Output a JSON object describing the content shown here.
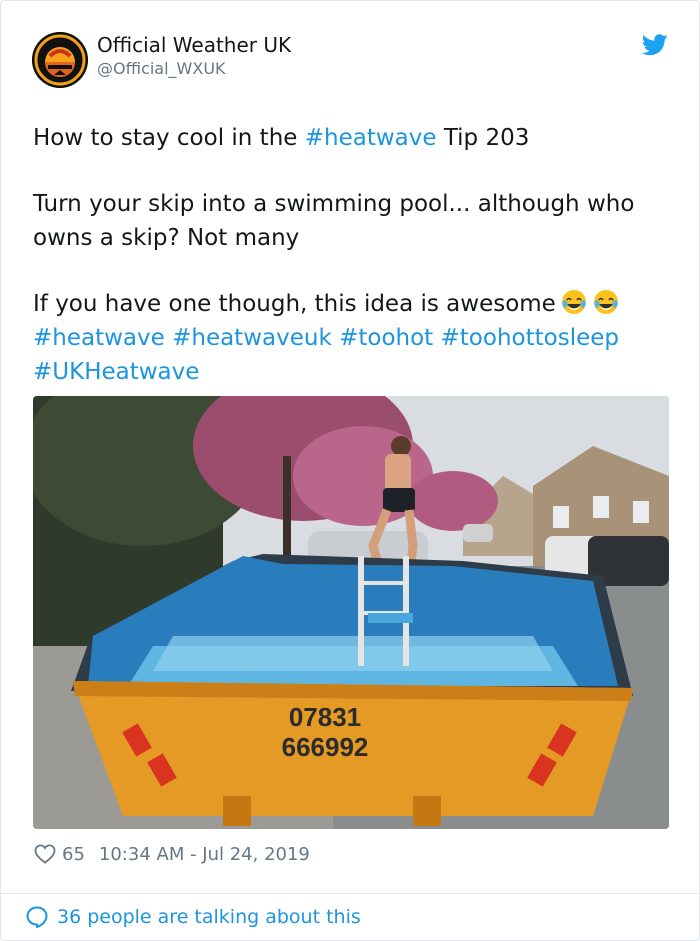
{
  "tweet": {
    "author": {
      "name": "Official Weather UK",
      "handle": "@Official_WXUK",
      "avatar_icon": "weather-logo-icon"
    },
    "brand_icon": "twitter-bird-icon",
    "lines": {
      "line1_pre": "How to stay cool in the ",
      "line1_tag": "#heatwave",
      "line1_post": " Tip 203",
      "para2": "Turn your skip into a swimming pool... although who owns a skip? Not many",
      "para3": "If you have one though, this idea is awesome",
      "emoji": "face-with-tears-of-joy",
      "tags": [
        "#heatwave",
        "#heatwaveuk",
        "#toohot",
        "#toohottosleep",
        "#UKHeatwave"
      ]
    },
    "image": {
      "skip_text_line1": "07831",
      "skip_text_line2": "666992"
    },
    "likes": "65",
    "timestamp": "10:34 AM - Jul 24, 2019",
    "footer": "36 people are talking about this"
  },
  "colors": {
    "link": "#1b95e0",
    "muted": "#657786",
    "text": "#14171a",
    "border": "#e1e8ed"
  }
}
